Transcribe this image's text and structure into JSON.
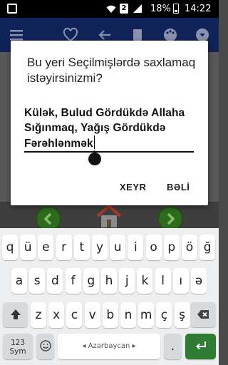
{
  "status_bar": {
    "sim_slot": "2",
    "battery_percent": "18%",
    "time": "14:22"
  },
  "toolbar": {
    "icons": [
      "menu-icon",
      "heart-icon",
      "back-arrow-icon",
      "book-icon",
      "palette-icon",
      "dropdown-icon"
    ]
  },
  "dialog": {
    "title": "Bu yeri Seçilmişlərdə saxlamaq istəyirsinizmi?",
    "input_value": "Külək, Bulud Gördükdə Allaha Sığınmaq, Yağış Gördükdə Fərəhlənmək",
    "buttons": {
      "no": "XEYR",
      "yes": "BƏLİ"
    }
  },
  "keyboard": {
    "row1": [
      "q",
      "ü",
      "e",
      "r",
      "t",
      "y",
      "u",
      "i",
      "o",
      "p",
      "ö",
      "ğ"
    ],
    "row2": [
      "a",
      "s",
      "d",
      "f",
      "g",
      "h",
      "j",
      "k",
      "l",
      "ı",
      "ə"
    ],
    "row3": [
      "z",
      "x",
      "c",
      "v",
      "b",
      "n",
      "m",
      "ç",
      "ş"
    ],
    "sym_key": "123\nSym",
    "space_label": "Azərbaycan",
    "period": ".",
    "accent_color": "#2e7d32"
  },
  "colors": {
    "toolbar": "#10245a",
    "nav_button": "#2f6b1e"
  }
}
